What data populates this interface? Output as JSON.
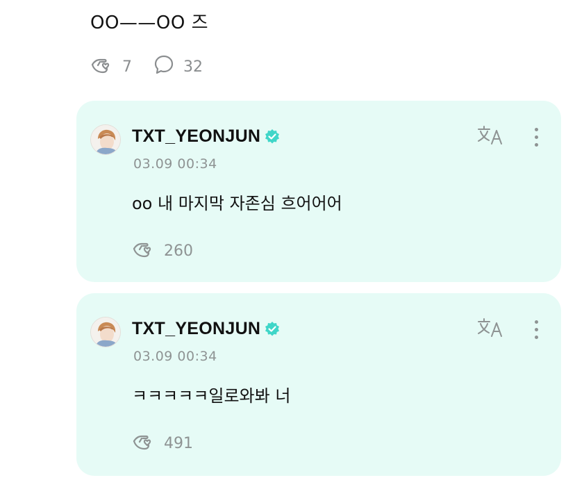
{
  "post": {
    "text": "OO——OO 즈",
    "like_count": "7",
    "comment_count": "32"
  },
  "replies": [
    {
      "author": "TXT_YEONJUN",
      "date": "03.09 00:34",
      "text": "oo 내 마지막 자존심 흐어어어",
      "like_count": "260"
    },
    {
      "author": "TXT_YEONJUN",
      "date": "03.09 00:34",
      "text": "ㅋㅋㅋㅋㅋ일로와봐 너",
      "like_count": "491"
    }
  ],
  "icons": {
    "like": "hand-heart-icon",
    "comment": "speech-bubble-icon",
    "verified": "verified-check-icon",
    "translate": "translate-icon",
    "more": "more-vertical-icon"
  },
  "colors": {
    "card_background": "#e6fbf6",
    "verified": "#3fd6c8",
    "muted": "#8e9393"
  }
}
